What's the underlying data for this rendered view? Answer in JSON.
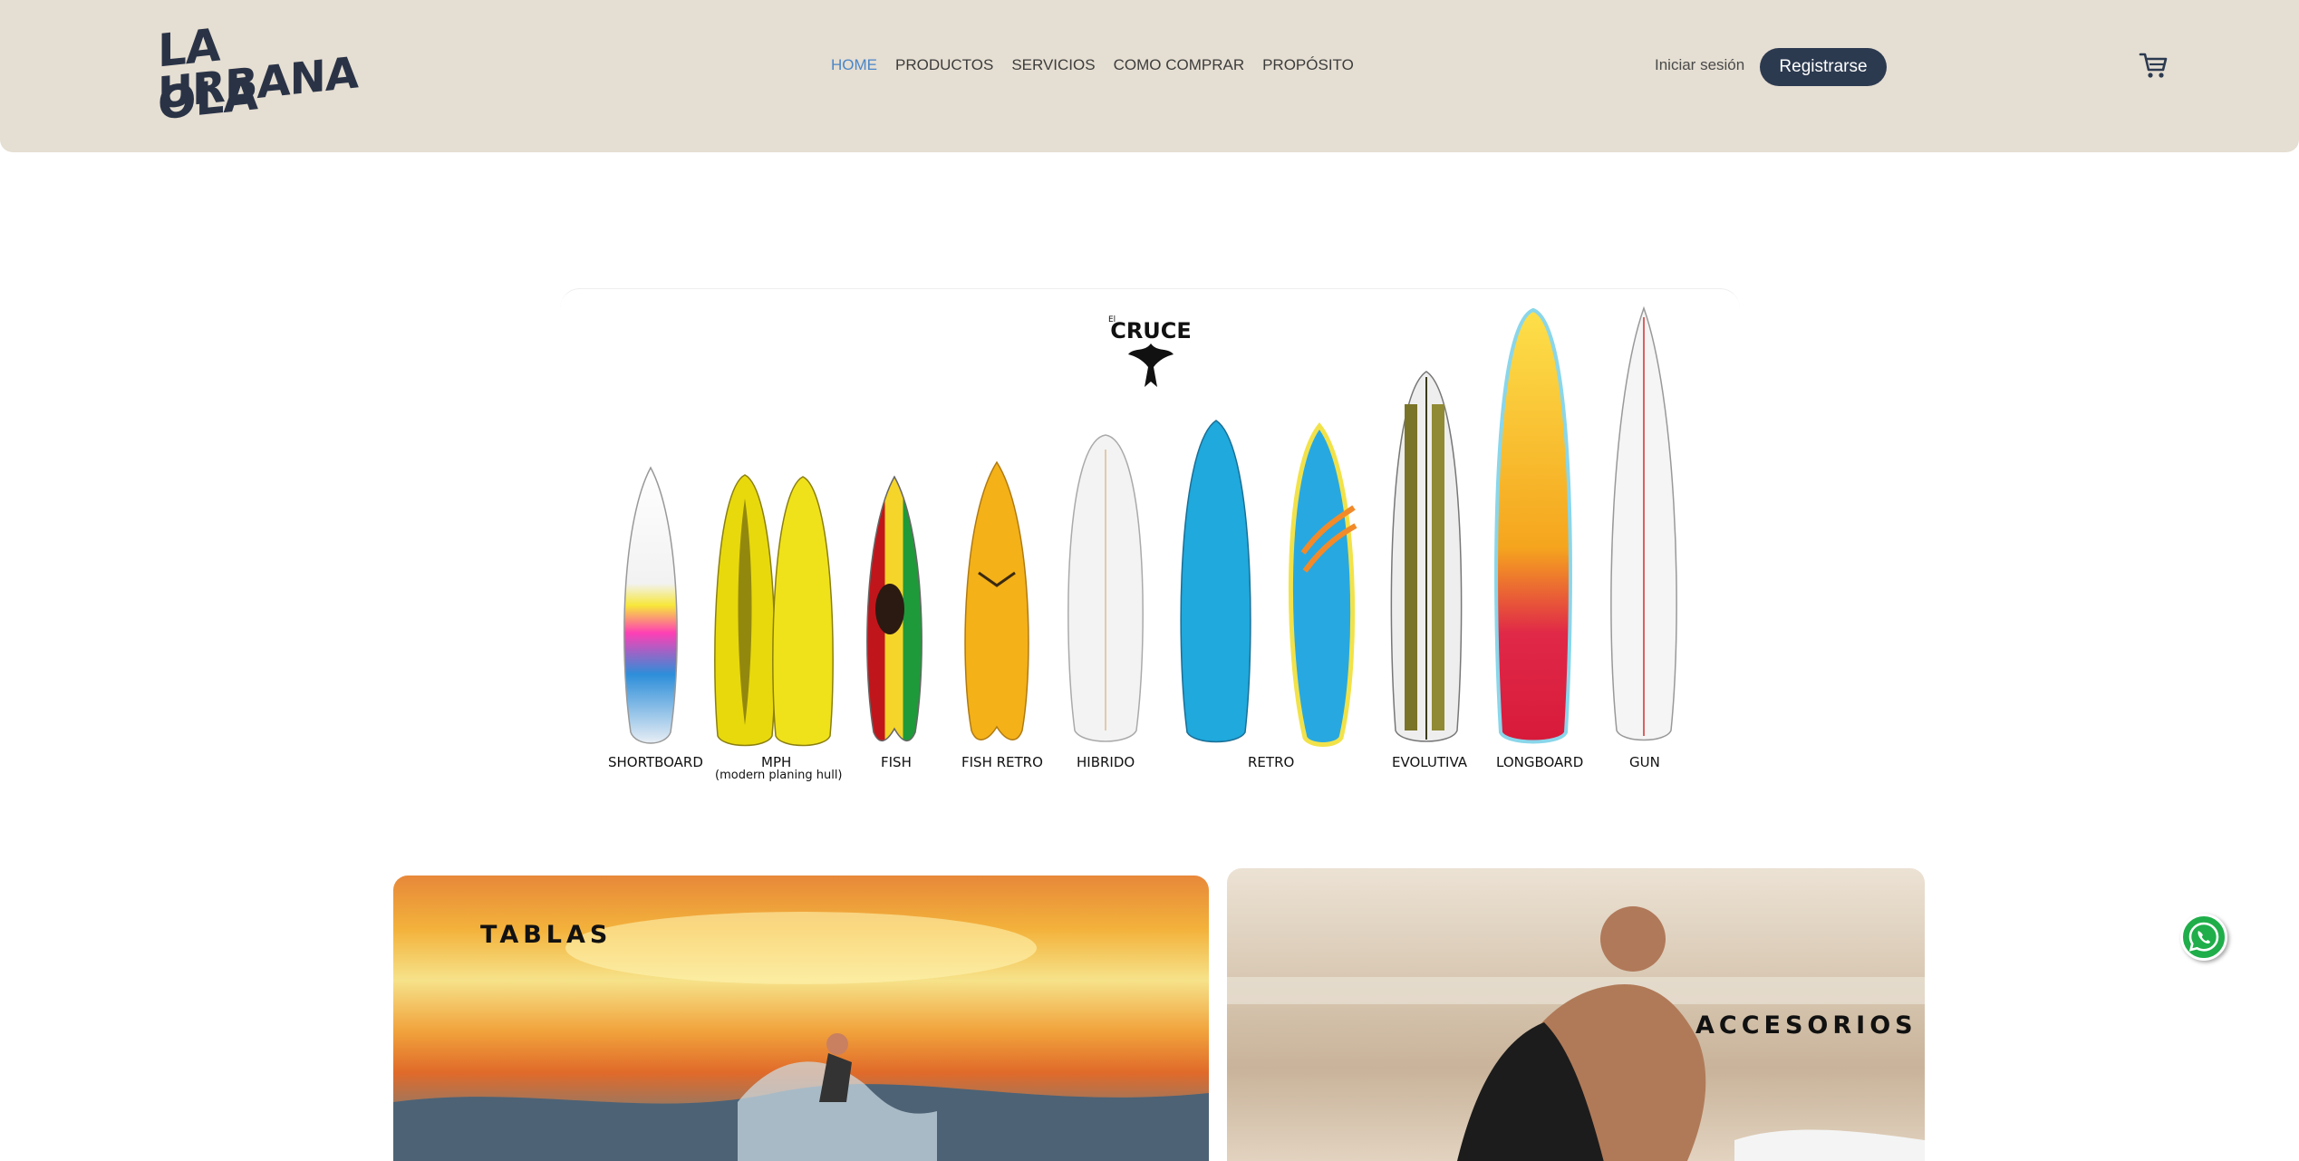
{
  "header": {
    "logo_text_line1": "LA OLA",
    "logo_text_line2": "URBANA",
    "nav": [
      {
        "label": "HOME",
        "active": true
      },
      {
        "label": "PRODUCTOS",
        "active": false
      },
      {
        "label": "SERVICIOS",
        "active": false
      },
      {
        "label": "COMO COMPRAR",
        "active": false
      },
      {
        "label": "PROPÓSITO",
        "active": false
      }
    ],
    "login_label": "Iniciar sesión",
    "register_label": "Registrarse",
    "cart_icon": "cart-icon"
  },
  "banner": {
    "brand": "CRUCE",
    "brand_prefix": "El",
    "boards": [
      {
        "label": "SHORTBOARD"
      },
      {
        "label": "MPH",
        "sublabel": "(modern planing hull)"
      },
      {
        "label": "FISH"
      },
      {
        "label": "FISH RETRO"
      },
      {
        "label": "HIBRIDO"
      },
      {
        "label": "RETRO"
      },
      {
        "label": "EVOLUTIVA"
      },
      {
        "label": "LONGBOARD"
      },
      {
        "label": "GUN"
      }
    ]
  },
  "categories": {
    "tablas": "TABLAS",
    "accesorios": "ACCESORIOS"
  },
  "colors": {
    "header_bg": "#e5ded2",
    "accent": "#4a86c8",
    "button_bg": "#2c3a50",
    "whatsapp": "#1fae4a"
  },
  "floating": {
    "whatsapp_icon": "whatsapp-icon"
  }
}
